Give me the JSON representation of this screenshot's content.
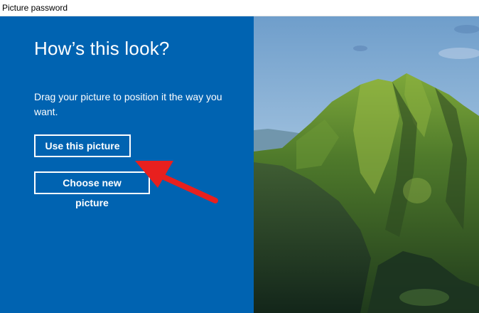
{
  "window": {
    "title": "Picture password"
  },
  "main": {
    "heading": "How’s this look?",
    "description": "Drag your picture to position it the way you want.",
    "use_button_label": "Use this picture",
    "choose_button_label": "Choose new picture"
  },
  "colors": {
    "panel_blue": "#0063b1",
    "annotation_red": "#e8201e"
  },
  "icons": {
    "annotation": "red-arrow-icon"
  }
}
